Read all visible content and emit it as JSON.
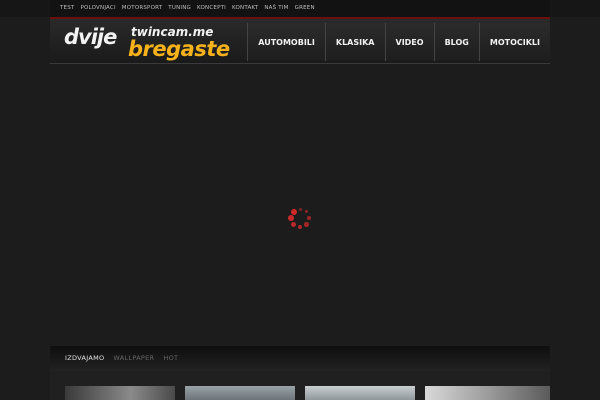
{
  "topnav": [
    "TEST",
    "POLOVNJACI",
    "MOTORSPORT",
    "TUNING",
    "KONCEPTI",
    "KONTAKT",
    "NAŠ TIM",
    "GREEN"
  ],
  "logo": {
    "part1": "dvije",
    "part2": "twincam.me",
    "part3": "bregaste",
    "colors": {
      "primary": "#f2f2f2",
      "accent": "#f7b21b"
    }
  },
  "mainnav": [
    "AUTOMOBILI",
    "KLASIKA",
    "VIDEO",
    "BLOG",
    "MOTOCIKLI"
  ],
  "loader": {
    "icon": "spinner-icon",
    "color": "#d12a2a"
  },
  "tabs": [
    {
      "label": "IZDVAJAMO",
      "active": true
    },
    {
      "label": "WALLPAPER",
      "active": false
    },
    {
      "label": "HOT",
      "active": false
    }
  ],
  "thumbnails": [
    "thumbnail-1",
    "thumbnail-2",
    "thumbnail-3",
    "thumbnail-4"
  ]
}
